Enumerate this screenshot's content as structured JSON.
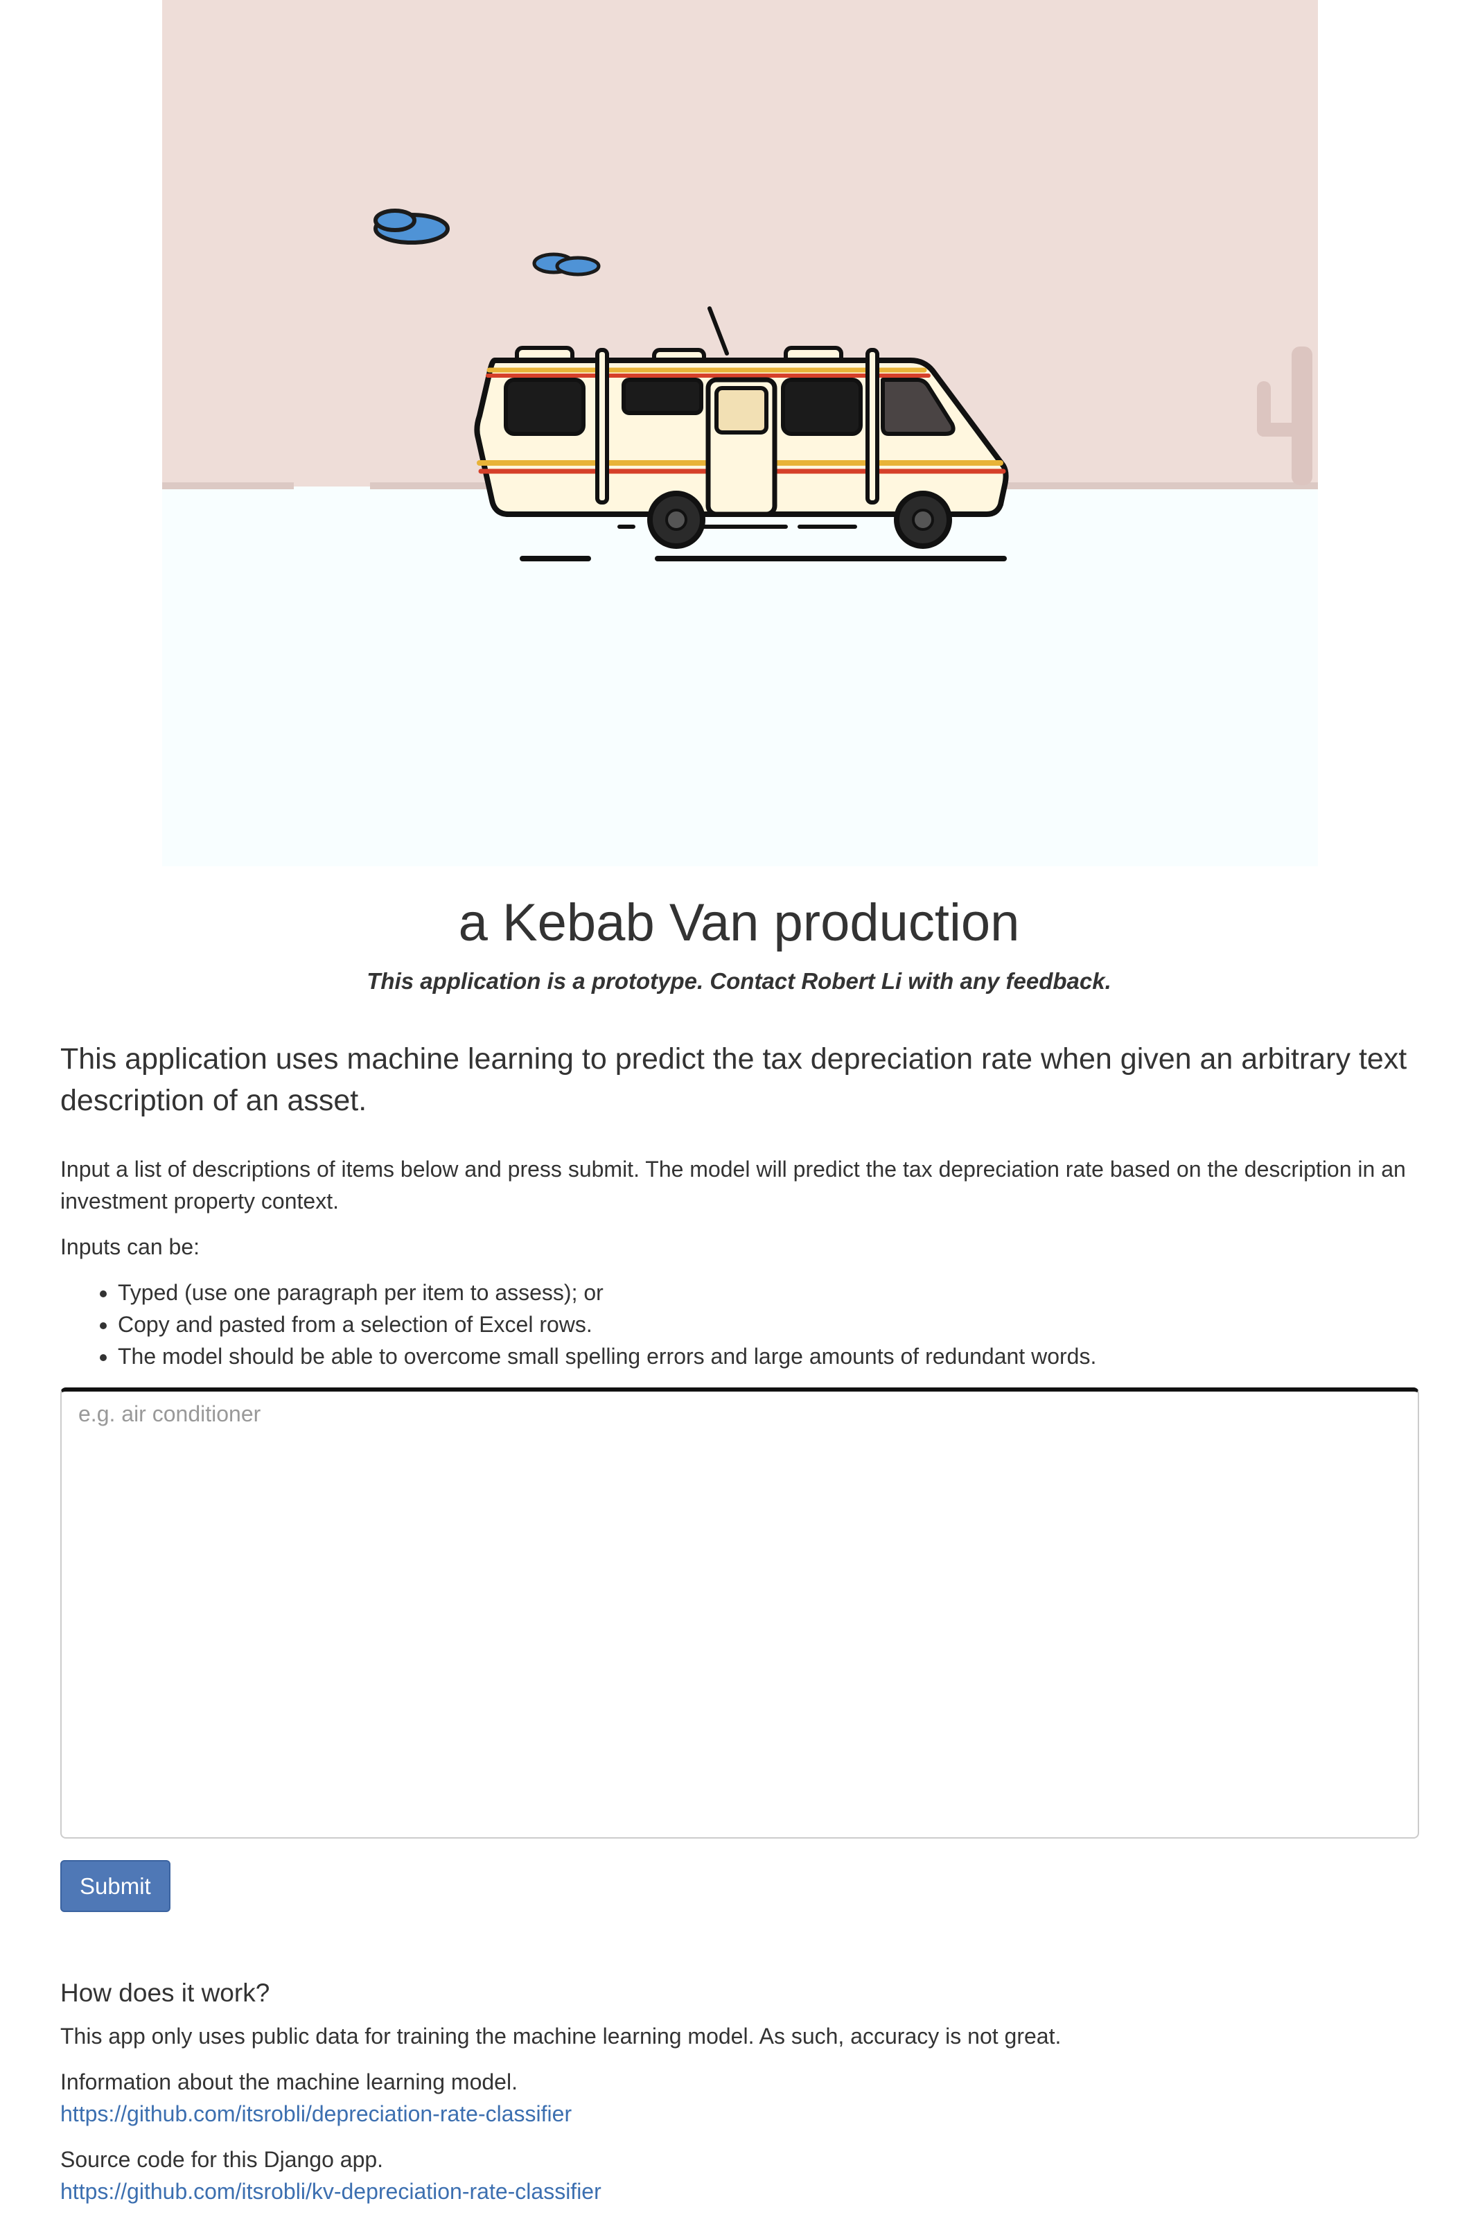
{
  "hero": {
    "sky_color": "#eeddd8",
    "ground_color": "#f8feff",
    "image_icon": "rv-van-desert-illustration"
  },
  "header": {
    "title": "a Kebab Van production",
    "subtitle": "This application is a prototype. Contact Robert Li with any feedback."
  },
  "intro": {
    "lead": "This application uses machine learning to predict the tax depreciation rate when given an arbitrary text description of an asset.",
    "instructions": "Input a list of descriptions of items below and press submit. The model will predict the tax depreciation rate based on the description in an investment property context.",
    "inputs_label": "Inputs can be:",
    "bullets": [
      "Typed (use one paragraph per item to assess); or",
      "Copy and pasted from a selection of Excel rows.",
      "The model should be able to overcome small spelling errors and large amounts of redundant words."
    ]
  },
  "form": {
    "textarea_value": "",
    "textarea_placeholder": "e.g. air conditioner",
    "submit_label": "Submit",
    "submit_color": "#4f78b6"
  },
  "about": {
    "heading": "How does it work?",
    "accuracy_note": "This app only uses public data for training the machine learning model. As such, accuracy is not great.",
    "model_info_label": "Information about the machine learning model.",
    "model_info_link": "https://github.com/itsrobli/depreciation-rate-classifier",
    "source_label": "Source code for this Django app.",
    "source_link": "https://github.com/itsrobli/kv-depreciation-rate-classifier",
    "link_color": "#3c6fb0"
  }
}
